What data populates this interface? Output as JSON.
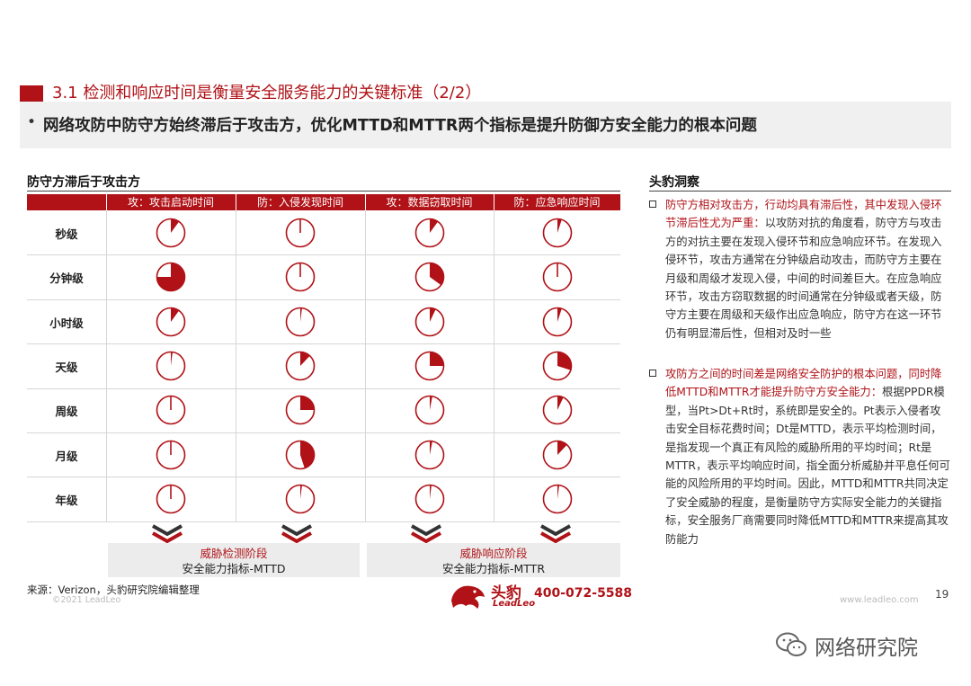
{
  "header": {
    "title": "3.1 检测和响应时间是衡量安全服务能力的关键标准（2/2）",
    "summary_bullet": "•",
    "summary": "网络攻防中防守方始终滞后于攻击方，优化MTTD和MTTR两个指标是提升防御方安全能力的根本问题"
  },
  "left_section": {
    "title": "防守方滞后于攻击方",
    "columns": [
      "攻：攻击启动时间",
      "防：入侵发现时间",
      "攻：数据窃取时间",
      "防：应急响应时间"
    ],
    "rows": [
      "秒级",
      "分钟级",
      "小时级",
      "天级",
      "周级",
      "月级",
      "年级"
    ],
    "note": "Each cell value = proportion of cases (pie filled fraction, 0-1)",
    "values": [
      [
        0.1,
        0.0,
        0.1,
        0.05
      ],
      [
        0.75,
        0.0,
        0.35,
        0.0
      ],
      [
        0.1,
        0.02,
        0.07,
        0.05
      ],
      [
        0.02,
        0.12,
        0.25,
        0.3
      ],
      [
        0.0,
        0.25,
        0.03,
        0.07
      ],
      [
        0.0,
        0.45,
        0.03,
        0.12
      ],
      [
        0.0,
        0.02,
        0.02,
        0.02
      ]
    ],
    "phases": [
      {
        "title": "威胁检测阶段",
        "sub": "安全能力指标-MTTD"
      },
      {
        "title": "威胁响应阶段",
        "sub": "安全能力指标-MTTR"
      }
    ],
    "source": "来源：Verizon，头豹研究院编辑整理",
    "copyright": "©2021 LeadLeo"
  },
  "right_section": {
    "title": "头豹洞察",
    "insights": [
      {
        "highlight": "防守方相对攻击方，行动均具有滞后性，其中发现入侵环节滞后性尤为严重：",
        "body": "以攻防对抗的角度看，防守方与攻击方的对抗主要在发现入侵环节和应急响应环节。在发现入侵环节，攻击方通常在分钟级启动攻击，而防守方主要在月级和周级才发现入侵，中间的时间差巨大。在应急响应环节，攻击方窃取数据的时间通常在分钟级或者天级，防守方主要在周级和天级作出应急响应，防守方在这一环节仍有明显滞后性，但相对及时一些"
      },
      {
        "highlight": "攻防方之间的时间差是网络安全防护的根本问题，同时降低MTTD和MTTR才能提升防守方安全能力：",
        "body": "根据PPDR模型，当Pt>Dt+Rt时，系统即是安全的。Pt表示入侵者攻击安全目标花费时间；Dt是MTTD，表示平均检测时间，是指发现一个真正有风险的威胁所用的平均时间；Rt是MTTR，表示平均响应时间，指全面分析威胁并平息任何可能的风险所用的平均时间。因此，MTTD和MTTR共同决定了安全威胁的程度，是衡量防守方实际安全能力的关键指标，安全服务厂商需要同时降低MTTD和MTTR来提高其攻防能力"
      }
    ]
  },
  "footer": {
    "logo_name": "头豹",
    "logo_sub": "LeadLeo",
    "phone": "400-072-5588",
    "site": "www.leadleo.com",
    "page": "19",
    "wechat": "网络研究院"
  },
  "colors": {
    "accent": "#b01217",
    "band": "#f0f0f0",
    "grid": "#d6d6d6"
  }
}
